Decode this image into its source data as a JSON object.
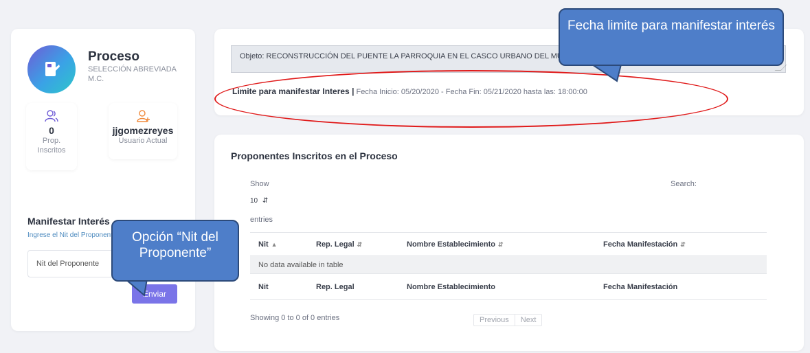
{
  "process": {
    "title": "Proceso",
    "subtitle": "SELECCIÓN ABREVIADA M.C."
  },
  "stats": {
    "proponents_count": "0",
    "proponents_label": "Prop. Inscritos",
    "username": "jjgomezreyes",
    "username_label": "Usuario Actual"
  },
  "interest_form": {
    "title": "Manifestar Interés",
    "help": "Ingrese el Nit del Proponente",
    "placeholder": "Nit del Proponente",
    "submit_label": "Enviar"
  },
  "objeto": {
    "text": "Objeto: RECONSTRUCCIÓN DEL PUENTE LA PARROQUIA EN EL CASCO URBANO DEL MUNICIPIO"
  },
  "limit": {
    "label": "Limite para manifestar Interes |",
    "details": "Fecha Inicio: 05/20/2020 - Fecha Fin: 05/21/2020 hasta las: 18:00:00"
  },
  "proponents": {
    "title": "Proponentes Inscritos en el Proceso",
    "show_label": "Show",
    "length_value": "10",
    "entries_label": "entries",
    "search_label": "Search:",
    "columns": [
      "Nit",
      "Rep. Legal",
      "Nombre Establecimiento",
      "Fecha Manifestación"
    ],
    "empty_message": "No data available in table",
    "info": "Showing 0 to 0 of 0 entries",
    "prev_label": "Previous",
    "next_label": "Next"
  },
  "annotations": {
    "fecha_callout": "Fecha limite para manifestar interés",
    "nit_callout": "Opción “Nit del Proponente”",
    "callout_color": "#4e7ec9",
    "highlight_color": "#e01a1a"
  },
  "colors": {
    "accent": "#7a74e8",
    "background": "#f1f2f6"
  }
}
